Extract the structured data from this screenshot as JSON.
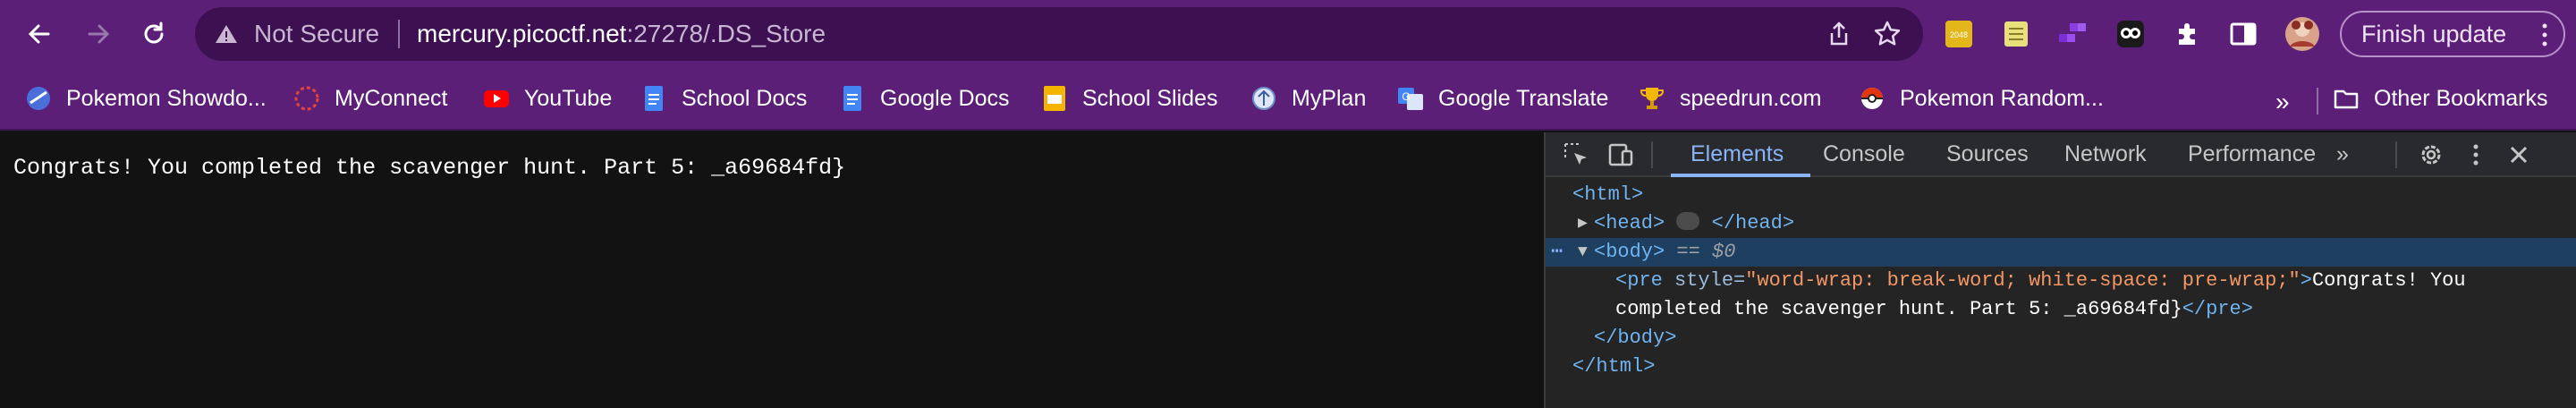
{
  "toolbar": {
    "back_icon": "arrow-left-icon",
    "forward_icon": "arrow-right-icon",
    "reload_icon": "reload-icon",
    "security_label": "Not Secure",
    "url_host": "mercury.picoctf.net",
    "url_rest": ":27278/.DS_Store",
    "finish_update_label": "Finish update"
  },
  "bookmarks": {
    "items": [
      {
        "label": "Pokemon Showdo...",
        "icon": "pokemon-showdown-icon"
      },
      {
        "label": "MyConnect",
        "icon": "myconnect-icon"
      },
      {
        "label": "YouTube",
        "icon": "youtube-icon"
      },
      {
        "label": "School Docs",
        "icon": "google-docs-icon"
      },
      {
        "label": "Google Docs",
        "icon": "google-docs-icon"
      },
      {
        "label": "School Slides",
        "icon": "google-slides-icon"
      },
      {
        "label": "MyPlan",
        "icon": "myplan-icon"
      },
      {
        "label": "Google Translate",
        "icon": "google-translate-icon"
      },
      {
        "label": "speedrun.com",
        "icon": "trophy-icon"
      },
      {
        "label": "Pokemon Random...",
        "icon": "pokeball-icon"
      }
    ],
    "more_label": "»",
    "other_label": "Other Bookmarks"
  },
  "page": {
    "text": "Congrats! You completed the scavenger hunt. Part 5: _a69684fd}"
  },
  "devtools": {
    "tabs": [
      "Elements",
      "Console",
      "Sources",
      "Network",
      "Performance"
    ],
    "active_tab": "Elements",
    "more_tabs": "»",
    "tree": {
      "html_open": "<html>",
      "head_open": "<head>",
      "head_close": "</head>",
      "body_open": "<body>",
      "body_marker": "== $0",
      "pre_open": "<pre",
      "pre_attr_name": "style",
      "pre_attr_value": "\"word-wrap: break-word; white-space: pre-wrap;\"",
      "pre_text_1": "Congrats! You",
      "pre_text_2": "completed the scavenger hunt. Part 5: _a69684fd}",
      "pre_close": "</pre>",
      "body_close": "</body>",
      "html_close": "</html>"
    }
  },
  "colors": {
    "toolbar_bg": "#5b1f78",
    "omnibox_bg": "#3d1052",
    "devtools_bg": "#242424",
    "page_bg": "#121212",
    "accent": "#8ab4f8"
  }
}
